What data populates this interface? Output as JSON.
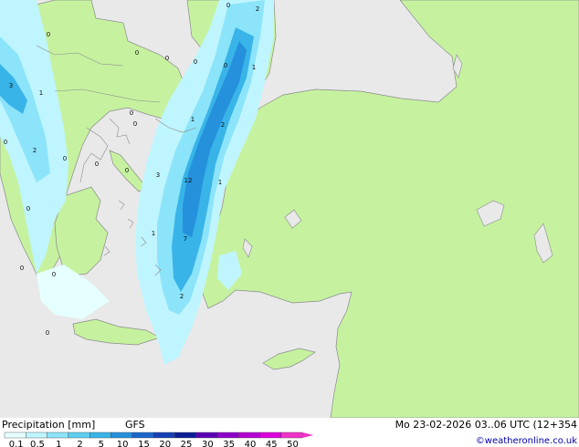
{
  "legend": {
    "title": "Precipitation [mm]",
    "model": "GFS",
    "datetime": "Mo 23-02-2026 03..06 UTC (12+354",
    "credit": "©weatheronline.co.uk",
    "bins": [
      {
        "label": "0.1",
        "color": "#e6ffff"
      },
      {
        "label": "0.5",
        "color": "#bff5ff"
      },
      {
        "label": "1",
        "color": "#8ce4fa"
      },
      {
        "label": "2",
        "color": "#5ccfef"
      },
      {
        "label": "5",
        "color": "#38b4e8"
      },
      {
        "label": "10",
        "color": "#2590dc"
      },
      {
        "label": "15",
        "color": "#1a66cc"
      },
      {
        "label": "20",
        "color": "#1440b4"
      },
      {
        "label": "25",
        "color": "#0c1e96"
      },
      {
        "label": "30",
        "color": "#5a00b4"
      },
      {
        "label": "35",
        "color": "#8c00c8"
      },
      {
        "label": "40",
        "color": "#b400d2"
      },
      {
        "label": "45",
        "color": "#dc00dc"
      },
      {
        "label": "50",
        "color": "#f032c8"
      }
    ]
  },
  "colors": {
    "land": "#c6f2a0",
    "sea": "#e9e9e9",
    "border": "#8a8a8a"
  },
  "map_values": [
    {
      "id": "v1",
      "text": "0"
    },
    {
      "id": "v2",
      "text": "2"
    },
    {
      "id": "v3",
      "text": "0"
    },
    {
      "id": "v4",
      "text": "0"
    },
    {
      "id": "v5",
      "text": "0"
    },
    {
      "id": "v6",
      "text": "0"
    },
    {
      "id": "v7",
      "text": "0"
    },
    {
      "id": "v8",
      "text": "1"
    },
    {
      "id": "v9",
      "text": "3"
    },
    {
      "id": "v10",
      "text": "1"
    },
    {
      "id": "v11",
      "text": "0"
    },
    {
      "id": "v12",
      "text": "1"
    },
    {
      "id": "v13",
      "text": "2"
    },
    {
      "id": "v14",
      "text": "0"
    },
    {
      "id": "v15",
      "text": "2"
    },
    {
      "id": "v16",
      "text": "0"
    },
    {
      "id": "v17",
      "text": "0"
    },
    {
      "id": "v18",
      "text": "0"
    },
    {
      "id": "v19",
      "text": "0"
    },
    {
      "id": "v20",
      "text": "3"
    },
    {
      "id": "v21",
      "text": "12"
    },
    {
      "id": "v22",
      "text": "1"
    },
    {
      "id": "v23",
      "text": "0"
    },
    {
      "id": "v24",
      "text": "1"
    },
    {
      "id": "v25",
      "text": "7"
    },
    {
      "id": "v26",
      "text": "0"
    },
    {
      "id": "v27",
      "text": "0"
    },
    {
      "id": "v28",
      "text": "2"
    },
    {
      "id": "v29",
      "text": "0"
    }
  ]
}
